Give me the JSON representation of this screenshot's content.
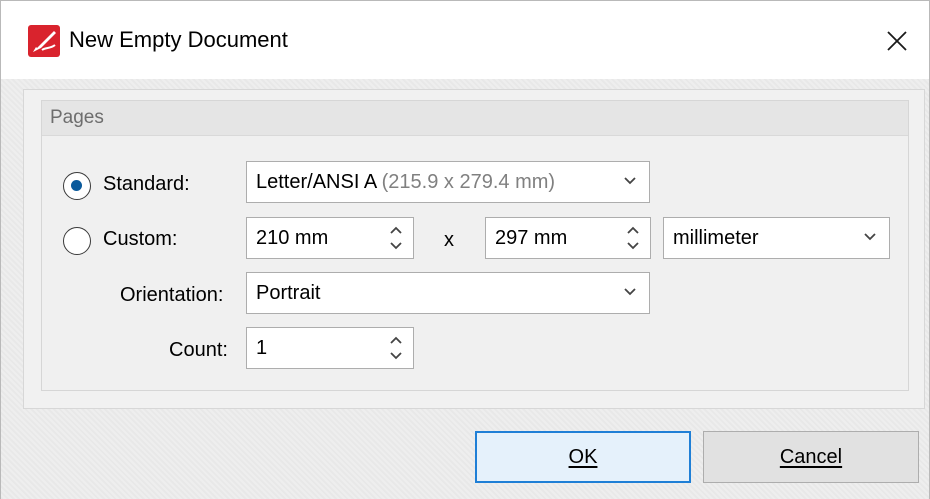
{
  "dialog": {
    "title": "New Empty Document",
    "icon": "pdf-editor-app-icon",
    "accent_color": "#d9232d"
  },
  "pages": {
    "group_title": "Pages",
    "standard": {
      "label": "Standard:",
      "selected": true,
      "value": "Letter/ANSI A",
      "value_detail": "(215.9 x 279.4 mm)"
    },
    "custom": {
      "label": "Custom:",
      "selected": false,
      "width": "210 mm",
      "separator": "x",
      "height": "297 mm",
      "unit": "millimeter"
    },
    "orientation": {
      "label": "Orientation:",
      "value": "Portrait"
    },
    "count": {
      "label": "Count:",
      "value": "1"
    }
  },
  "buttons": {
    "ok": "OK",
    "cancel": "Cancel"
  }
}
